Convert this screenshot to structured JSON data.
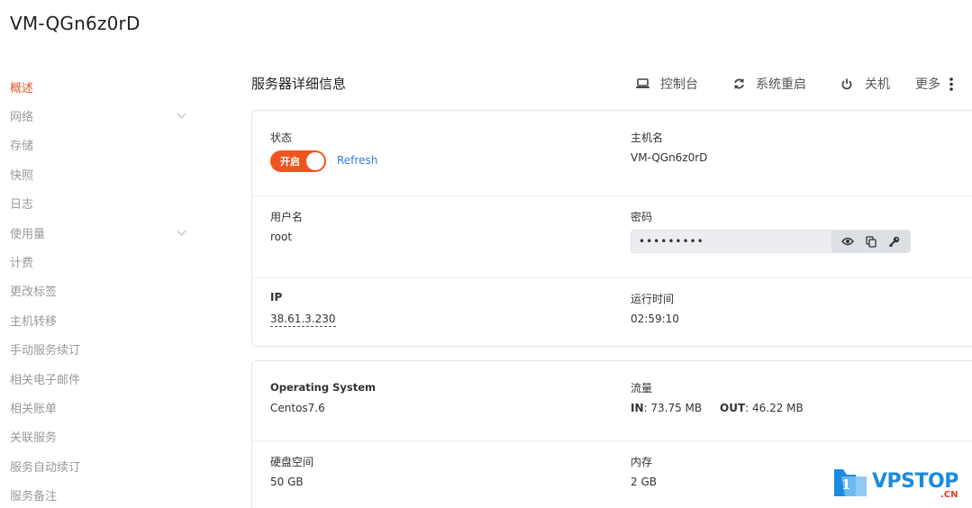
{
  "page": {
    "title": "VM-QGn6z0rD"
  },
  "sidebar": {
    "items": [
      {
        "label": "概述",
        "active": true,
        "expandable": false
      },
      {
        "label": "网络",
        "active": false,
        "expandable": true
      },
      {
        "label": "存储",
        "active": false,
        "expandable": false
      },
      {
        "label": "快照",
        "active": false,
        "expandable": false
      },
      {
        "label": "日志",
        "active": false,
        "expandable": false
      },
      {
        "label": "使用量",
        "active": false,
        "expandable": true
      },
      {
        "label": "计费",
        "active": false,
        "expandable": false
      },
      {
        "label": "更改标签",
        "active": false,
        "expandable": false
      },
      {
        "label": "主机转移",
        "active": false,
        "expandable": false
      },
      {
        "label": "手动服务续订",
        "active": false,
        "expandable": false
      },
      {
        "label": "相关电子邮件",
        "active": false,
        "expandable": false
      },
      {
        "label": "相关账单",
        "active": false,
        "expandable": false
      },
      {
        "label": "关联服务",
        "active": false,
        "expandable": false
      },
      {
        "label": "服务自动续订",
        "active": false,
        "expandable": false
      },
      {
        "label": "服务备注",
        "active": false,
        "expandable": false
      }
    ]
  },
  "main": {
    "section_title": "服务器详细信息",
    "toolbar": {
      "console": {
        "label": "控制台",
        "icon": "laptop-icon"
      },
      "reboot": {
        "label": "系统重启",
        "icon": "refresh-icon"
      },
      "shutdown": {
        "label": "关机",
        "icon": "power-icon"
      },
      "more": {
        "label": "更多",
        "icon": "more-vertical-icon"
      }
    },
    "details": {
      "status_label": "状态",
      "status_toggle": "开启",
      "refresh_label": "Refresh",
      "hostname_label": "主机名",
      "hostname_value": "VM-QGn6z0rD",
      "username_label": "用户名",
      "username_value": "root",
      "password_label": "密码",
      "password_value": "•••••••••",
      "ip_label": "IP",
      "ip_value": "38.61.3.230",
      "uptime_label": "运行时间",
      "uptime_value": "02:59:10"
    },
    "specs": {
      "os_label": "Operating System",
      "os_value": "Centos7.6",
      "traffic_label": "流量",
      "traffic_in_label": "IN",
      "traffic_in_value": ": 73.75 MB",
      "traffic_out_label": "OUT",
      "traffic_out_value": ": 46.22 MB",
      "disk_label": "硬盘空间",
      "disk_value": "50 GB",
      "memory_label": "内存",
      "memory_value": "2 GB"
    }
  },
  "watermark": {
    "badge": "1",
    "text": "VPSTOP",
    "sub": ".CN"
  },
  "colors": {
    "accent": "#e8572a",
    "toggle": "#f0551f",
    "link": "#3a7bd5",
    "watermark": "#1a8be0"
  }
}
